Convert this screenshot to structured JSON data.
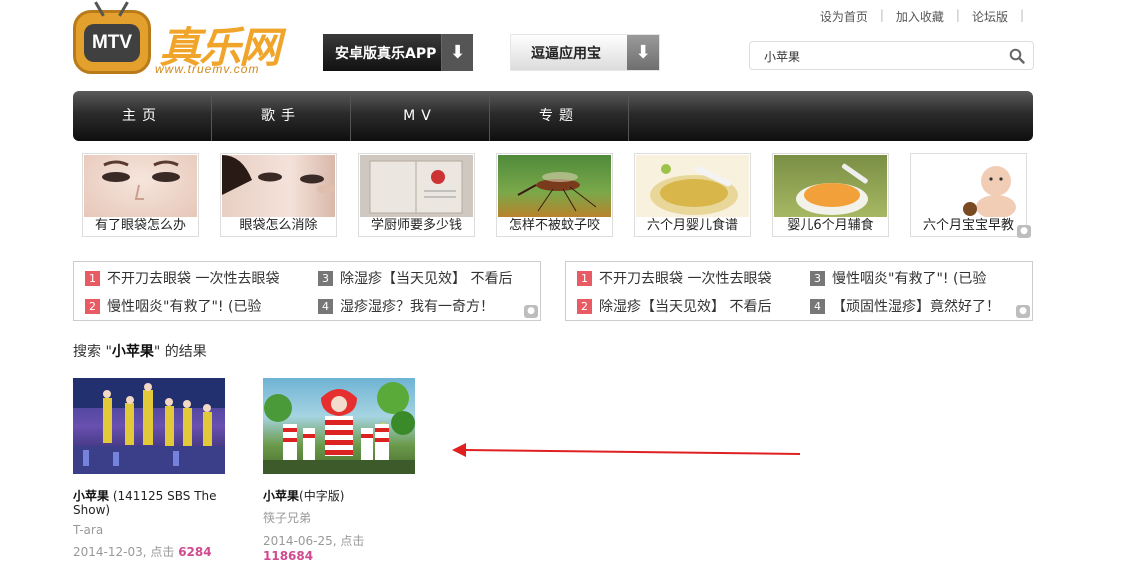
{
  "toplinks": {
    "home": "设为首页",
    "fav": "加入收藏",
    "forum": "论坛版"
  },
  "logo": {
    "tv_text": "MTV",
    "title": "真乐网",
    "subtitle": "www.truemv.com"
  },
  "app_buttons": {
    "android": "安卓版真乐APP",
    "doubi": "逗逼应用宝"
  },
  "search": {
    "value": "小苹果"
  },
  "nav": [
    "主页",
    "歌手",
    "MV",
    "专题"
  ],
  "thumbs": [
    {
      "caption": "有了眼袋怎么办"
    },
    {
      "caption": "眼袋怎么消除"
    },
    {
      "caption": "学厨师要多少钱"
    },
    {
      "caption": "怎样不被蚊子咬"
    },
    {
      "caption": "六个月婴儿食谱"
    },
    {
      "caption": "婴儿6个月辅食"
    },
    {
      "caption": "六个月宝宝早教"
    }
  ],
  "hotbox_left": [
    {
      "n": "1",
      "text": "不开刀去眼袋 一次性去眼袋"
    },
    {
      "n": "3",
      "text": "除湿疹【当天见效】 不看后"
    },
    {
      "n": "2",
      "text": "慢性咽炎\"有救了\"! (已验"
    },
    {
      "n": "4",
      "text": "湿疹湿疹？我有一奇方！"
    }
  ],
  "hotbox_right": [
    {
      "n": "1",
      "text": "不开刀去眼袋 一次性去眼袋"
    },
    {
      "n": "3",
      "text": "慢性咽炎\"有救了\"! (已验"
    },
    {
      "n": "2",
      "text": "除湿疹【当天见效】 不看后"
    },
    {
      "n": "4",
      "text": "【顽固性湿疹】竟然好了！"
    }
  ],
  "results": {
    "prefix": "搜索 \"",
    "query": "小苹果",
    "suffix": "\" 的结果",
    "items": [
      {
        "title": "小苹果",
        "extra": " (141125 SBS The Show)",
        "artist": "T-ara",
        "date": "2014-12-03, 点击 ",
        "hits": "6284"
      },
      {
        "title": "小苹果",
        "extra": "(中字版)",
        "artist": "筷子兄弟",
        "date": "2014-06-25, 点击 ",
        "hits": "118684"
      }
    ]
  },
  "colors": {
    "accent_pink": "#d04a8f",
    "rank_red": "#e85b64",
    "logo_orange": "#f0a52a",
    "arrow_red": "#e02020"
  }
}
